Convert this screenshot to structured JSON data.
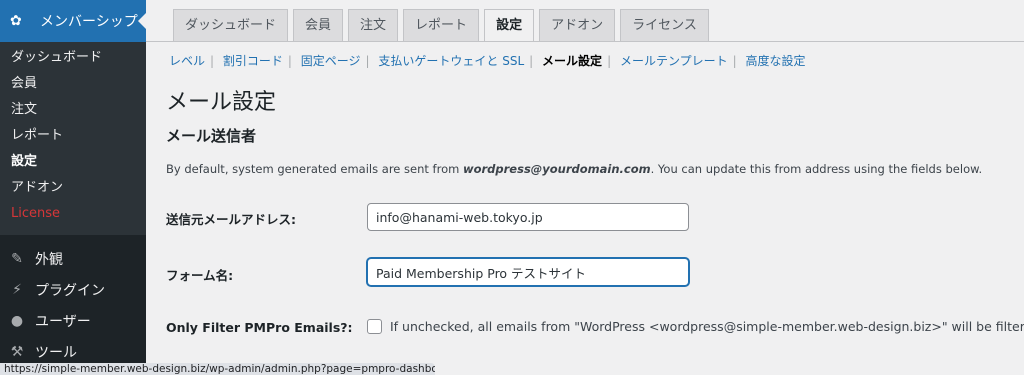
{
  "sidebar": {
    "head": {
      "icon": "paw-icon",
      "label": "メンバーシップ"
    },
    "sub_items": [
      "ダッシュボード",
      "会員",
      "注文",
      "レポート",
      "設定",
      "アドオン",
      "License"
    ],
    "top_items": [
      {
        "icon": "brush-icon",
        "label": "外観"
      },
      {
        "icon": "plugin-icon",
        "label": "プラグイン"
      },
      {
        "icon": "user-icon",
        "label": "ユーザー"
      },
      {
        "icon": "wrench-icon",
        "label": "ツール"
      }
    ]
  },
  "tabs": [
    "ダッシュボード",
    "会員",
    "注文",
    "レポート",
    "設定",
    "アドオン",
    "ライセンス"
  ],
  "subnav": [
    "レベル",
    "割引コード",
    "固定ページ",
    "支払いゲートウェイと SSL",
    "メール設定",
    "メールテンプレート",
    "高度な設定"
  ],
  "page_title": "メール設定",
  "section_title": "メール送信者",
  "description": {
    "before": "By default, system generated emails are sent from ",
    "email": "wordpress@yourdomain.com",
    "after": ". You can update this from address using the fields below."
  },
  "from_email": {
    "label": "送信元メールアドレス:",
    "value": "info@hanami-web.tokyo.jp"
  },
  "from_name": {
    "label": "フォーム名:",
    "value": "Paid Membership Pro テストサイト"
  },
  "only_filter": {
    "label": "Only Filter PMPro Emails?:",
    "text": "If unchecked, all emails from \"WordPress <wordpress@simple-member.web-design.biz>\" will be filtered to use the above settings."
  },
  "status_url": "https://simple-member.web-design.biz/wp-admin/admin.php?page=pmpro-dashboard",
  "colors": {
    "accent": "#2271b1",
    "sidebar": "#1d2327",
    "license": "#d63638"
  }
}
